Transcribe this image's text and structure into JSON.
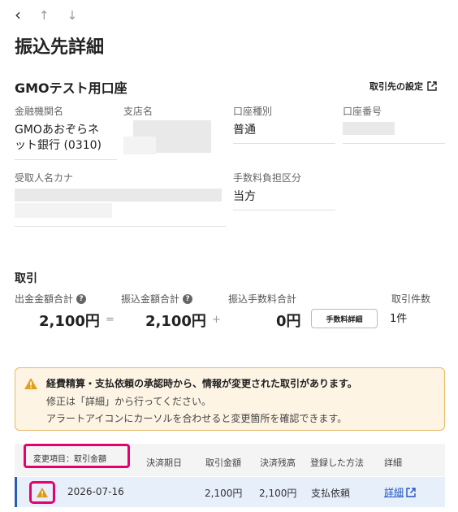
{
  "nav": {
    "back": "‹",
    "up": "↑",
    "down": "↓"
  },
  "page_title": "振込先詳細",
  "account": {
    "name": "GMOテスト用口座",
    "settings_link": "取引先の設定"
  },
  "fields": {
    "bank_label": "金融機関名",
    "bank_value_line1": "GMOあおぞらネ",
    "bank_value_line2": "ット銀行 (0310)",
    "branch_label": "支店名",
    "account_type_label": "口座種別",
    "account_type_value": "普通",
    "account_number_label": "口座番号",
    "recipient_kana_label": "受取人名カナ",
    "fee_bearer_label": "手数料負担区分",
    "fee_bearer_value": "当方"
  },
  "transactions": {
    "title": "取引",
    "payout_total_label": "出金金額合計",
    "payout_total_value": "2,100円",
    "transfer_total_label": "振込金額合計",
    "transfer_total_value": "2,100円",
    "fee_total_label": "振込手数料合計",
    "fee_total_value": "0円",
    "fee_detail_button": "手数料詳細",
    "count_label": "取引件数",
    "count_value": "1件",
    "op_equals": "=",
    "op_plus": "+"
  },
  "alert": {
    "line1": "経費精算・支払依頼の承認時から、情報が変更された取引があります。",
    "line2": "修正は「詳細」から行ってください。",
    "line3": "アラートアイコンにカーソルを合わせると変更箇所を確認できます。"
  },
  "table": {
    "headers": [
      "変更項目：取引金額",
      "決済期日",
      "取引金額",
      "決済残高",
      "登録した方法",
      "詳細"
    ],
    "rows": [
      {
        "date": "2026-07-16",
        "amount": "2,100円",
        "balance": "2,100円",
        "method": "支払依頼",
        "detail": "詳細"
      }
    ]
  },
  "colors": {
    "accent": "#e6006e",
    "link": "#2255c0",
    "warning": "#e0a020"
  }
}
